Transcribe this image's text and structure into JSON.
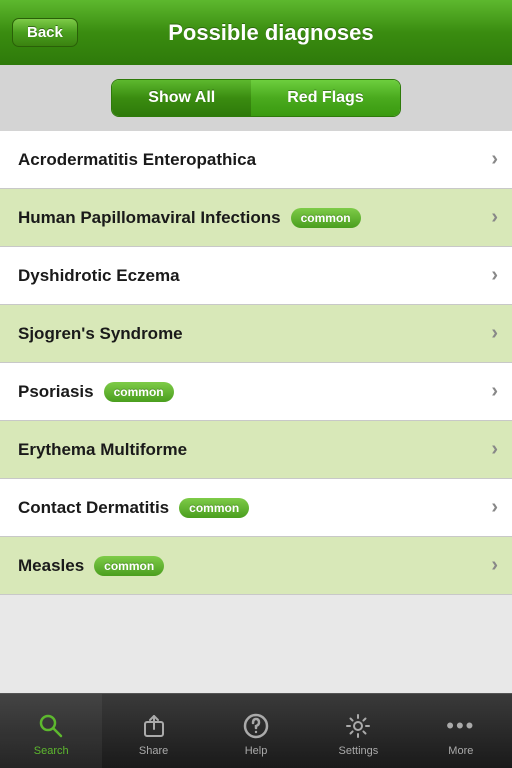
{
  "header": {
    "back_label": "Back",
    "title": "Possible diagnoses"
  },
  "filter": {
    "show_all_label": "Show All",
    "red_flags_label": "Red Flags"
  },
  "diagnoses": [
    {
      "name": "Acrodermatitis Enteropathica",
      "common": false,
      "highlighted": false
    },
    {
      "name": "Human Papillomaviral Infections",
      "common": true,
      "highlighted": true
    },
    {
      "name": "Dyshidrotic Eczema",
      "common": false,
      "highlighted": false
    },
    {
      "name": "Sjogren's Syndrome",
      "common": false,
      "highlighted": true
    },
    {
      "name": "Psoriasis",
      "common": true,
      "highlighted": false
    },
    {
      "name": "Erythema Multiforme",
      "common": false,
      "highlighted": true
    },
    {
      "name": "Contact Dermatitis",
      "common": true,
      "highlighted": false
    },
    {
      "name": "Measles",
      "common": true,
      "highlighted": true
    }
  ],
  "common_badge_label": "common",
  "tabs": [
    {
      "id": "search",
      "label": "Search",
      "active": true
    },
    {
      "id": "share",
      "label": "Share",
      "active": false
    },
    {
      "id": "help",
      "label": "Help",
      "active": false
    },
    {
      "id": "settings",
      "label": "Settings",
      "active": false
    },
    {
      "id": "more",
      "label": "More",
      "active": false
    }
  ]
}
